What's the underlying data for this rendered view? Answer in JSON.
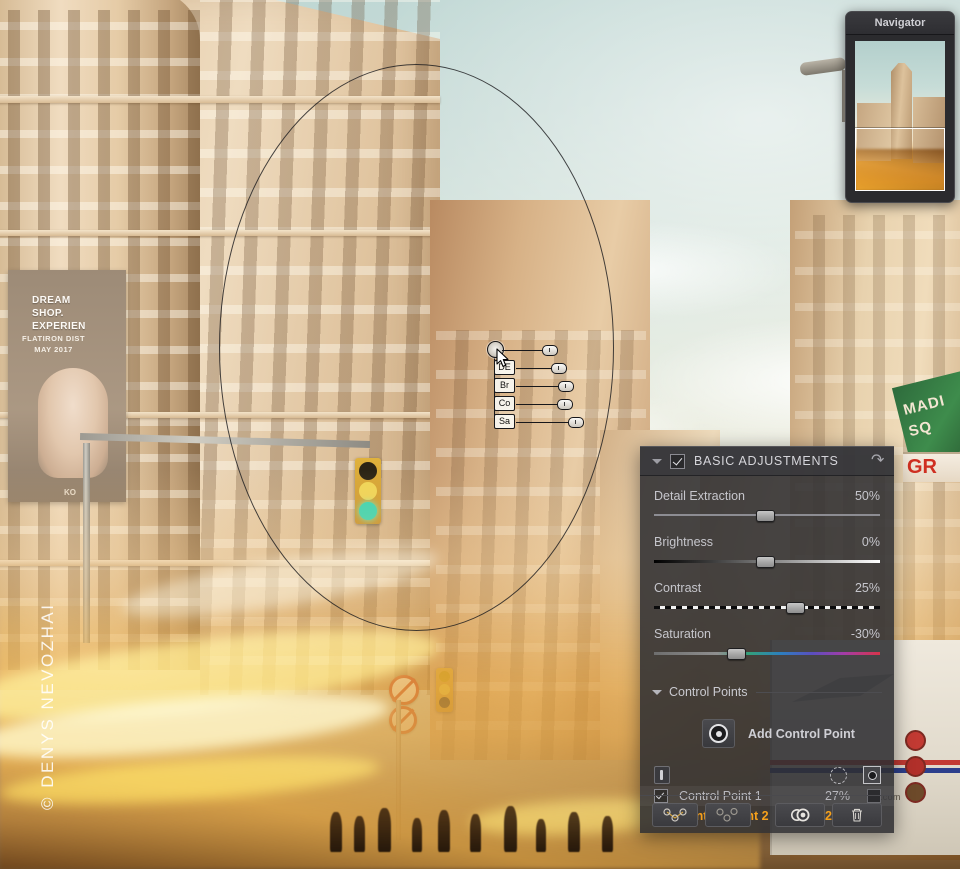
{
  "navigator": {
    "title": "Navigator"
  },
  "photo": {
    "watermark": "© DENYS NEVOZHAI",
    "billboard": {
      "line1": "DREAM",
      "line2": "SHOP.",
      "line3": "EXPERIEN",
      "sub1": "FLATIRON DIST",
      "sub2": "MAY 2017",
      "corner": "KO"
    },
    "signs": {
      "green_line1": "MADI",
      "green_line2": "SQ",
      "red": "GR"
    },
    "truck": {
      "url": ".com"
    }
  },
  "control_point_widget": {
    "sliders": [
      {
        "label": "DE",
        "knob_pct": 72
      },
      {
        "label": "Br",
        "knob_pct": 70
      },
      {
        "label": "Co",
        "knob_pct": 82
      },
      {
        "label": "Sa",
        "knob_pct": 92
      }
    ]
  },
  "panel": {
    "header": {
      "title": "BASIC ADJUSTMENTS",
      "enabled": true,
      "reset_icon": "↶"
    },
    "sliders": [
      {
        "name": "detail-extraction",
        "label": "Detail Extraction",
        "value": "50%",
        "knob_pct": 49,
        "track": "plain"
      },
      {
        "name": "brightness",
        "label": "Brightness",
        "value": "0%",
        "knob_pct": 49,
        "track": "bw"
      },
      {
        "name": "contrast",
        "label": "Contrast",
        "value": "25%",
        "knob_pct": 62,
        "track": "dashes"
      },
      {
        "name": "saturation",
        "label": "Saturation",
        "value": "-30%",
        "knob_pct": 36,
        "track": "rainbow"
      }
    ],
    "control_points": {
      "section_title": "Control Points",
      "add_button_label": "Add Control Point",
      "rows": [
        {
          "name": "Control Point 1",
          "opacity": "27%",
          "checked": true,
          "active": false
        },
        {
          "name": "Control Point 2",
          "opacity": "27%",
          "checked": true,
          "active": true
        }
      ],
      "toolbar": {
        "group_label": "group-control-points",
        "ungroup_label": "ungroup-control-points",
        "duplicate_label": "duplicate-control-point",
        "delete_label": "delete-control-point"
      }
    }
  },
  "colors": {
    "panel_bg": "#2f2f32",
    "accent_amber": "#f5a01c",
    "text_primary": "#c9c9cf",
    "traffic_green": "#35d7b6"
  }
}
